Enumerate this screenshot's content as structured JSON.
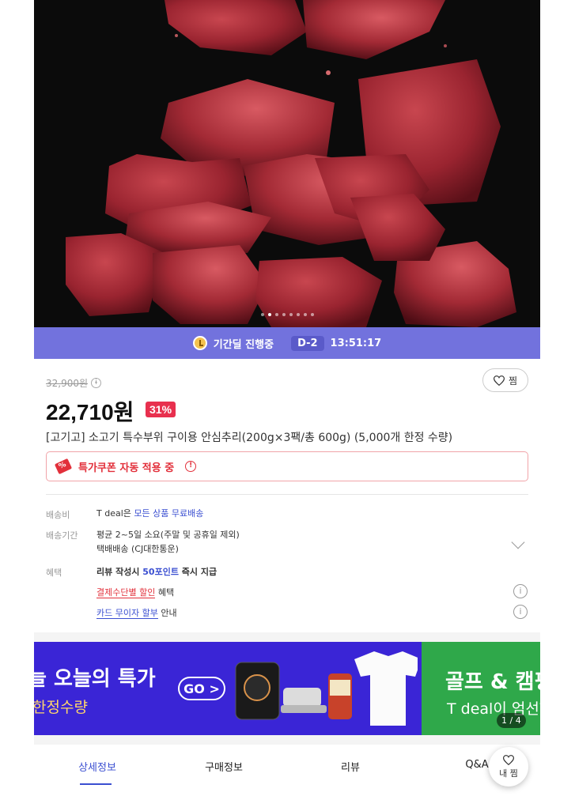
{
  "hero": {
    "slide_count": 8,
    "active_slide": 2
  },
  "deal_bar": {
    "label": "기간딜 진행중",
    "dday": "D-2",
    "timer": "13:51:17"
  },
  "product": {
    "original_price": "32,900원",
    "price": "22,710원",
    "discount": "31%",
    "wish_label": "찜",
    "title": "[고기고] 소고기 특수부위 구이용 안심추리(200g×3팩/총 600g) (5,000개 한정 수량)",
    "coupon": "특가쿠폰 자동 적용 중"
  },
  "shipping": {
    "fee_label": "배송비",
    "fee_prefix": "T deal은 ",
    "fee_highlight": "모든 상품 무료배송",
    "period_label": "배송기간",
    "period_line1": "평균 2~5일 소요(주말 및 공휴일 제외)",
    "period_line2": "택배배송 (CJ대한통운)",
    "benefit_label": "혜택",
    "benefit_prefix": "리뷰 작성시 ",
    "benefit_points": "50포인트",
    "benefit_suffix": " 즉시 지급",
    "payment_link": "결제수단별 할인",
    "payment_suffix": " 혜택",
    "card_link": "카드 무이자 할부",
    "card_suffix": " 안내"
  },
  "banner": {
    "left_title": "늘 오늘의 특가",
    "left_sub": "한정수량",
    "go": "GO >",
    "right_title": "골프 & 캠핑",
    "right_sub": "T deal이 엄선한",
    "pager": "1 / 4"
  },
  "tabs": [
    "상세정보",
    "구매정보",
    "리뷰",
    "Q&A"
  ],
  "active_tab": 0,
  "fab_label": "내 찜",
  "colors": {
    "deal_bar": "#7272dd",
    "discount": "#e8304e",
    "accent_blue": "#3b4fd1",
    "banner_blue": "#3a25d6",
    "banner_green": "#2fa84a"
  }
}
